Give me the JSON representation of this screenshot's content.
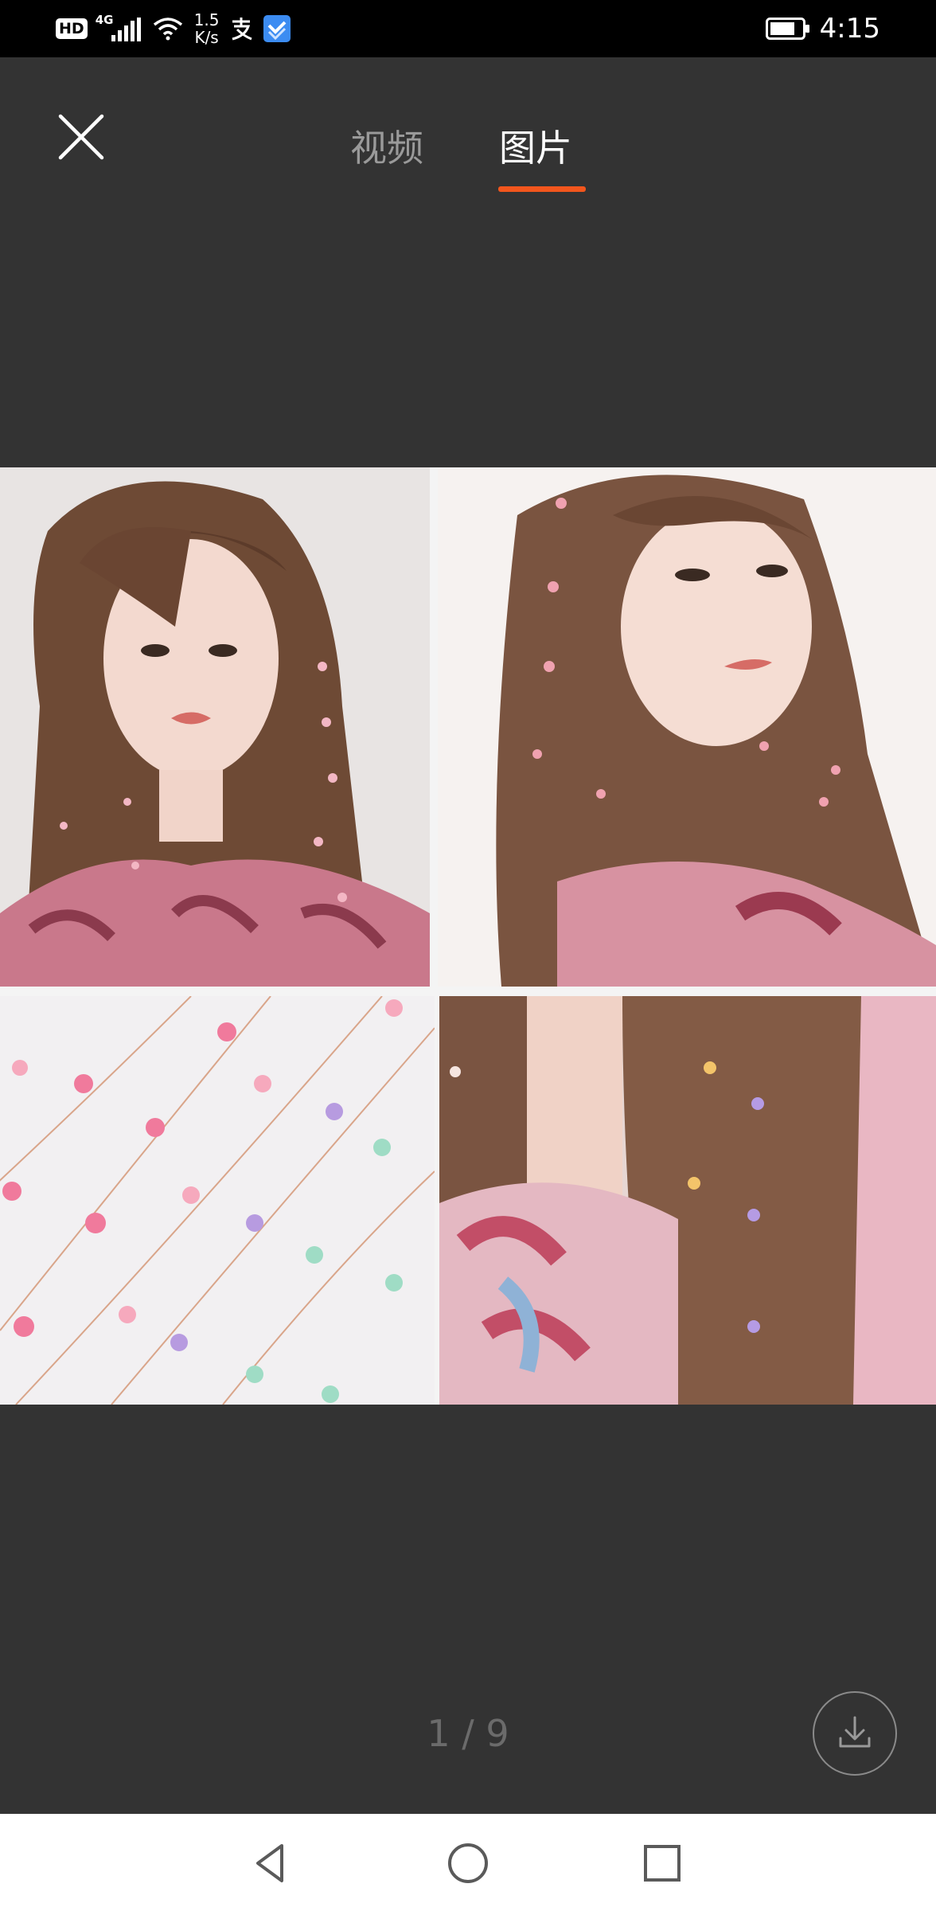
{
  "status_bar": {
    "hd": "HD",
    "network": "4G",
    "speed_value": "1.5",
    "speed_unit": "K/s",
    "time": "4:15",
    "icons": [
      "signal-icon",
      "wifi-icon",
      "alipay-icon",
      "app-check-icon",
      "battery-icon"
    ]
  },
  "header": {
    "close_icon": "close-icon",
    "tabs": [
      {
        "label": "视频",
        "active": false
      },
      {
        "label": "图片",
        "active": true
      }
    ],
    "active_color": "#f2561d"
  },
  "viewer": {
    "image_description": "four-panel product photo collage of flower hair string accessories",
    "page_indicator": "1 / 9"
  },
  "actions": {
    "download_icon": "download-icon"
  },
  "nav_bar": {
    "icons": [
      "back-triangle-icon",
      "home-circle-icon",
      "recents-square-icon"
    ]
  }
}
